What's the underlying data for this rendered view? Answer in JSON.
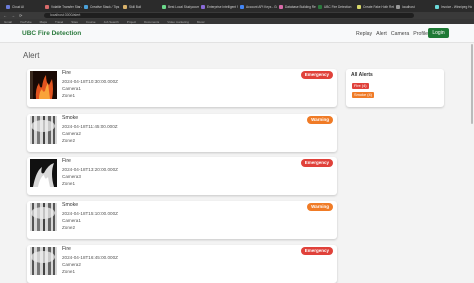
{
  "browser": {
    "tabs": [
      {
        "title": "Cloud AI",
        "color": "#6a7bd8"
      },
      {
        "title": "Volatile Transfer Star & Rec",
        "color": "#d86a6a"
      },
      {
        "title": "Creative Stack / Tips",
        "color": "#4aa0d8"
      },
      {
        "title": "Skill Buil",
        "color": "#d8b16a"
      },
      {
        "title": "Best Local Studycourses",
        "color": "#6ad88a"
      },
      {
        "title": "Enterprise Intelligent Search",
        "color": "#8a6ad8"
      },
      {
        "title": "Account API Keys - Google Cl",
        "color": "#4285f4"
      },
      {
        "title": "Database Building Require",
        "color": "#d86aa8"
      },
      {
        "title": "UBC Fire Detection",
        "color": "#2b7a3d"
      },
      {
        "title": "Create Fake Hoth Rebel Alt",
        "color": "#d8d86a"
      },
      {
        "title": "localhost",
        "color": "#999999"
      },
      {
        "title": "Invoice - Winnipeg Hotel-3",
        "color": "#6ad8d8"
      }
    ],
    "url": "localhost:3000/alert",
    "bookmarks": [
      "Gmail",
      "YouTube",
      "Maps",
      "Travel",
      "Sites",
      "Course",
      "Job Search",
      "Project",
      "Documents",
      "Video marketing",
      "Music"
    ]
  },
  "app": {
    "brand": "UBC Fire Detection",
    "nav": [
      "Replay",
      "Alert",
      "Camera",
      "Profile"
    ],
    "login": "Login",
    "page_title": "Alert"
  },
  "alerts": [
    {
      "type": "Fire",
      "time": "2024-04-18T10:30:00.000Z",
      "camera": "Camera1",
      "zone": "Zone1",
      "severity": "Emergency",
      "badge_color": "#e0413a",
      "thumb": "fire"
    },
    {
      "type": "Smoke",
      "time": "2024-04-18T11:45:00.000Z",
      "camera": "Camera2",
      "zone": "Zone2",
      "severity": "Warning",
      "badge_color": "#f07b26",
      "thumb": "smoke"
    },
    {
      "type": "Fire",
      "time": "2024-04-18T13:20:00.000Z",
      "camera": "Camera3",
      "zone": "Zone1",
      "severity": "Emergency",
      "badge_color": "#e0413a",
      "thumb": "fire-dark"
    },
    {
      "type": "Smoke",
      "time": "2024-04-18T15:10:00.000Z",
      "camera": "Camera1",
      "zone": "Zone2",
      "severity": "Warning",
      "badge_color": "#f07b26",
      "thumb": "smoke"
    },
    {
      "type": "Fire",
      "time": "2024-04-18T16:45:00.000Z",
      "camera": "Camera2",
      "zone": "Zone1",
      "severity": "Emergency",
      "badge_color": "#e0413a",
      "thumb": "smoke"
    }
  ],
  "summary": {
    "title": "All Alerts",
    "items": [
      {
        "label": "Fire (4)",
        "color": "#e0413a"
      },
      {
        "label": "Smoke (4)",
        "color": "#f07b26"
      }
    ]
  }
}
